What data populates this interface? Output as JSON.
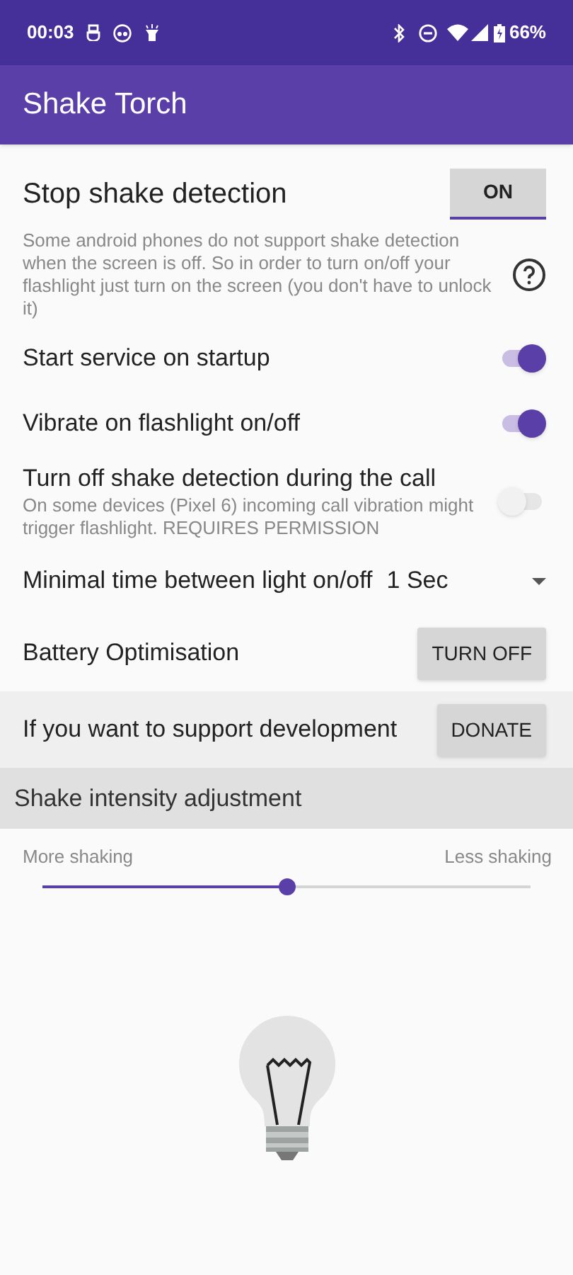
{
  "status_bar": {
    "time": "00:03",
    "battery": "66%"
  },
  "app_bar": {
    "title": "Shake Torch"
  },
  "stop_detection": {
    "label": "Stop shake detection",
    "button": "ON",
    "description": "Some android phones do not support shake detection when the screen is off. So in order to turn on/off your flashlight just turn on the screen (you don't have to unlock it)"
  },
  "switches": [
    {
      "label": "Start service on startup",
      "on": true
    },
    {
      "label": "Vibrate on flashlight on/off",
      "on": true
    },
    {
      "label": "Turn off shake detection during the call",
      "subtitle": "On some devices (Pixel 6) incoming call vibration might trigger flashlight. REQUIRES PERMISSION",
      "on": false
    }
  ],
  "minimal_time": {
    "label": "Minimal time between light on/off",
    "value": "1 Sec"
  },
  "battery": {
    "label": "Battery Optimisation",
    "button": "TURN OFF"
  },
  "donate": {
    "label": "If you want to support development",
    "button": "DONATE"
  },
  "intensity": {
    "header": "Shake intensity adjustment",
    "min_label": "More shaking",
    "max_label": "Less shaking",
    "level": 0.5
  }
}
